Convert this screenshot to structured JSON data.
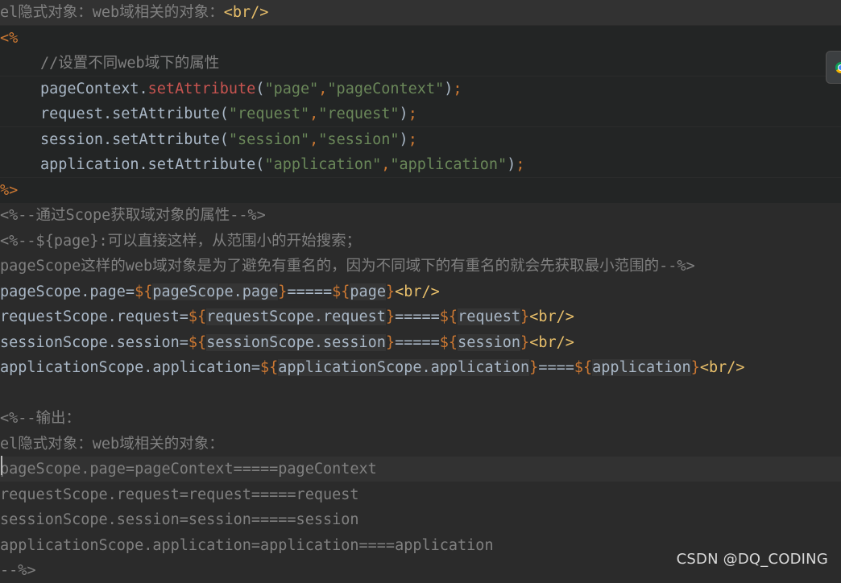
{
  "editor": {
    "lines": [
      {
        "indent": false,
        "style": "current",
        "segments": [
          {
            "type": "comment",
            "text": "el隐式对象：web域相关的对象："
          },
          {
            "type": "tag",
            "text": "<br/>"
          }
        ]
      },
      {
        "indent": false,
        "style": "scriptlet",
        "segments": [
          {
            "type": "jsp",
            "text": "<%"
          }
        ]
      },
      {
        "indent": true,
        "style": "scriptlet",
        "segments": [
          {
            "type": "comment",
            "text": "//设置不同web域下的属性"
          }
        ]
      },
      {
        "indent": true,
        "style": "scriptlet",
        "segments": [
          {
            "type": "default",
            "text": "pageContext."
          },
          {
            "type": "method",
            "text": "setAttribute"
          },
          {
            "type": "default",
            "text": "("
          },
          {
            "type": "string",
            "text": "\"page\""
          },
          {
            "type": "jsp",
            "text": ","
          },
          {
            "type": "string",
            "text": "\"pageContext\""
          },
          {
            "type": "default",
            "text": ")"
          },
          {
            "type": "jsp",
            "text": ";"
          }
        ]
      },
      {
        "indent": true,
        "style": "scriptlet",
        "segments": [
          {
            "type": "default",
            "text": "request.setAttribute("
          },
          {
            "type": "string",
            "text": "\"request\""
          },
          {
            "type": "jsp",
            "text": ","
          },
          {
            "type": "string",
            "text": "\"request\""
          },
          {
            "type": "default",
            "text": ")"
          },
          {
            "type": "jsp",
            "text": ";"
          }
        ]
      },
      {
        "indent": true,
        "style": "scriptlet",
        "segments": [
          {
            "type": "default",
            "text": "session.setAttribute("
          },
          {
            "type": "string",
            "text": "\"session\""
          },
          {
            "type": "jsp",
            "text": ","
          },
          {
            "type": "string",
            "text": "\"session\""
          },
          {
            "type": "default",
            "text": ")"
          },
          {
            "type": "jsp",
            "text": ";"
          }
        ]
      },
      {
        "indent": true,
        "style": "scriptlet",
        "segments": [
          {
            "type": "default",
            "text": "application.setAttribute("
          },
          {
            "type": "string",
            "text": "\"application\""
          },
          {
            "type": "jsp",
            "text": ","
          },
          {
            "type": "string",
            "text": "\"application\""
          },
          {
            "type": "default",
            "text": ")"
          },
          {
            "type": "jsp",
            "text": ";"
          }
        ]
      },
      {
        "indent": false,
        "style": "scriptlet",
        "segments": [
          {
            "type": "jsp",
            "text": "%>"
          }
        ]
      },
      {
        "indent": false,
        "style": "normal",
        "segments": [
          {
            "type": "comment",
            "text": "<%--通过Scope获取域对象的属性--%>"
          }
        ]
      },
      {
        "indent": false,
        "style": "normal",
        "segments": [
          {
            "type": "comment",
            "text": "<%--${page}:可以直接这样，从范围小的开始搜索；"
          }
        ]
      },
      {
        "indent": false,
        "style": "normal",
        "segments": [
          {
            "type": "comment",
            "text": "pageScope这样的web域对象是为了避免有重名的，因为不同域下的有重名的就会先获取最小范围的--%>"
          }
        ]
      },
      {
        "indent": false,
        "style": "normal",
        "segments": [
          {
            "type": "default",
            "text": "pageScope.page="
          },
          {
            "type": "el-brace",
            "text": "${"
          },
          {
            "type": "el",
            "text": "pageScope.page"
          },
          {
            "type": "el-brace",
            "text": "}"
          },
          {
            "type": "default",
            "text": "====="
          },
          {
            "type": "el-brace",
            "text": "${"
          },
          {
            "type": "el",
            "text": "page"
          },
          {
            "type": "el-brace",
            "text": "}"
          },
          {
            "type": "tag",
            "text": "<br/>"
          }
        ]
      },
      {
        "indent": false,
        "style": "normal",
        "segments": [
          {
            "type": "default",
            "text": "requestScope.request="
          },
          {
            "type": "el-brace",
            "text": "${"
          },
          {
            "type": "el",
            "text": "requestScope.request"
          },
          {
            "type": "el-brace",
            "text": "}"
          },
          {
            "type": "default",
            "text": "====="
          },
          {
            "type": "el-brace",
            "text": "${"
          },
          {
            "type": "el",
            "text": "request"
          },
          {
            "type": "el-brace",
            "text": "}"
          },
          {
            "type": "tag",
            "text": "<br/>"
          }
        ]
      },
      {
        "indent": false,
        "style": "normal",
        "segments": [
          {
            "type": "default",
            "text": "sessionScope.session="
          },
          {
            "type": "el-brace",
            "text": "${"
          },
          {
            "type": "el",
            "text": "sessionScope.session"
          },
          {
            "type": "el-brace",
            "text": "}"
          },
          {
            "type": "default",
            "text": "====="
          },
          {
            "type": "el-brace",
            "text": "${"
          },
          {
            "type": "el",
            "text": "session"
          },
          {
            "type": "el-brace",
            "text": "}"
          },
          {
            "type": "tag",
            "text": "<br/>"
          }
        ]
      },
      {
        "indent": false,
        "style": "normal",
        "segments": [
          {
            "type": "default",
            "text": "applicationScope.application="
          },
          {
            "type": "el-brace",
            "text": "${"
          },
          {
            "type": "el",
            "text": "applicationScope.application"
          },
          {
            "type": "el-brace",
            "text": "}"
          },
          {
            "type": "default",
            "text": "===="
          },
          {
            "type": "el-brace",
            "text": "${"
          },
          {
            "type": "el",
            "text": "application"
          },
          {
            "type": "el-brace",
            "text": "}"
          },
          {
            "type": "tag",
            "text": "<br/>"
          }
        ]
      },
      {
        "indent": false,
        "style": "normal",
        "segments": []
      },
      {
        "indent": false,
        "style": "normal",
        "segments": [
          {
            "type": "comment",
            "text": "<%--输出："
          }
        ]
      },
      {
        "indent": false,
        "style": "normal",
        "segments": [
          {
            "type": "comment",
            "text": "el隐式对象：web域相关的对象："
          }
        ]
      },
      {
        "indent": false,
        "style": "current",
        "segments": [
          {
            "type": "comment",
            "text": "pageScope.page=pageContext=====pageContext"
          }
        ]
      },
      {
        "indent": false,
        "style": "normal",
        "segments": [
          {
            "type": "comment",
            "text": "requestScope.request=request=====request"
          }
        ]
      },
      {
        "indent": false,
        "style": "normal",
        "segments": [
          {
            "type": "comment",
            "text": "sessionScope.session=session=====session"
          }
        ]
      },
      {
        "indent": false,
        "style": "normal",
        "segments": [
          {
            "type": "comment",
            "text": "applicationScope.application=application====application"
          }
        ]
      },
      {
        "indent": false,
        "style": "normal",
        "segments": [
          {
            "type": "comment",
            "text": "--%>"
          }
        ]
      }
    ]
  },
  "side_button": {
    "icon": "browser-icon"
  },
  "watermark": "CSDN @DQ_CODING",
  "colors": {
    "background": "#2b2b2b",
    "scriptlet_background": "#232525",
    "current_line": "#323232",
    "default_text": "#a9b7c6",
    "tag": "#e8bf6a",
    "jsp_keyword": "#cc7832",
    "string": "#6a8759",
    "method": "#c75450",
    "comment": "#808080"
  }
}
